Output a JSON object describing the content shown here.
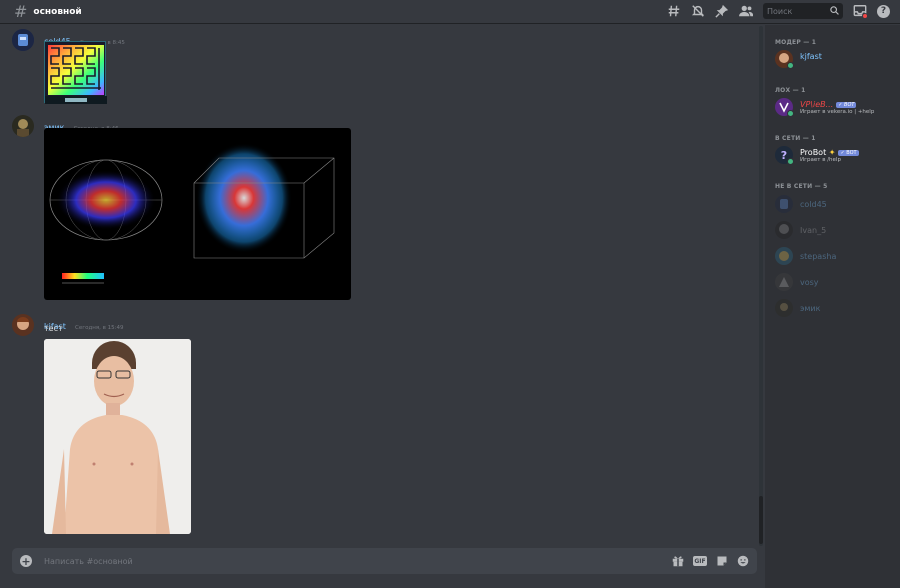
{
  "header": {
    "channel_name": "основной",
    "search_placeholder": "Поиск",
    "icons": [
      "threads-icon",
      "mute-icon",
      "pin-icon",
      "members-icon",
      "inbox-icon",
      "help-icon"
    ]
  },
  "messages": [
    {
      "author": "cold45",
      "timestamp": "Сегодня, в 8:45",
      "text": "",
      "attachment": "hilbert-curve-image"
    },
    {
      "author": "эмик",
      "timestamp": "Сегодня, в 8:46",
      "text": "",
      "attachment": "galaxy-map-image"
    },
    {
      "author": "kjfast",
      "timestamp": "Сегодня, в 15:49",
      "text": "тест",
      "attachment": "photo-image"
    }
  ],
  "composer": {
    "placeholder": "Написать #основной",
    "gif_label": "GIF"
  },
  "members": {
    "sections": [
      {
        "title": "МОДЕР — 1"
      },
      {
        "title": "ЛОХ — 1"
      },
      {
        "title": "В СЕТИ — 1"
      },
      {
        "title": "НЕ В СЕТИ — 5"
      }
    ],
    "list": [
      {
        "name": "kjfast",
        "activity": "",
        "color": "#7fc5ff"
      },
      {
        "name": "VP\\ieB...",
        "activity": "Играет в vekera.io | +help",
        "color": "#f04747",
        "bot": "✓ BOT"
      },
      {
        "name": "ProBot",
        "activity": "Играет в /help",
        "color": "#ffffff",
        "bot": "✓ BOT"
      },
      {
        "name": "cold45",
        "activity": "",
        "color": "#7fc5ff"
      },
      {
        "name": "Ivan_5",
        "activity": "",
        "color": "#b9bbbe"
      },
      {
        "name": "stepasha",
        "activity": "",
        "color": "#7fc5ff"
      },
      {
        "name": "vosy",
        "activity": "",
        "color": "#7fc5ff"
      },
      {
        "name": "эмик",
        "activity": "",
        "color": "#7fc5ff"
      }
    ]
  },
  "colors": {
    "background": "#36393f",
    "sidebar": "#2f3136",
    "username": "#7fc5ff",
    "online": "#43b581",
    "bot_tag": "#7289da"
  }
}
